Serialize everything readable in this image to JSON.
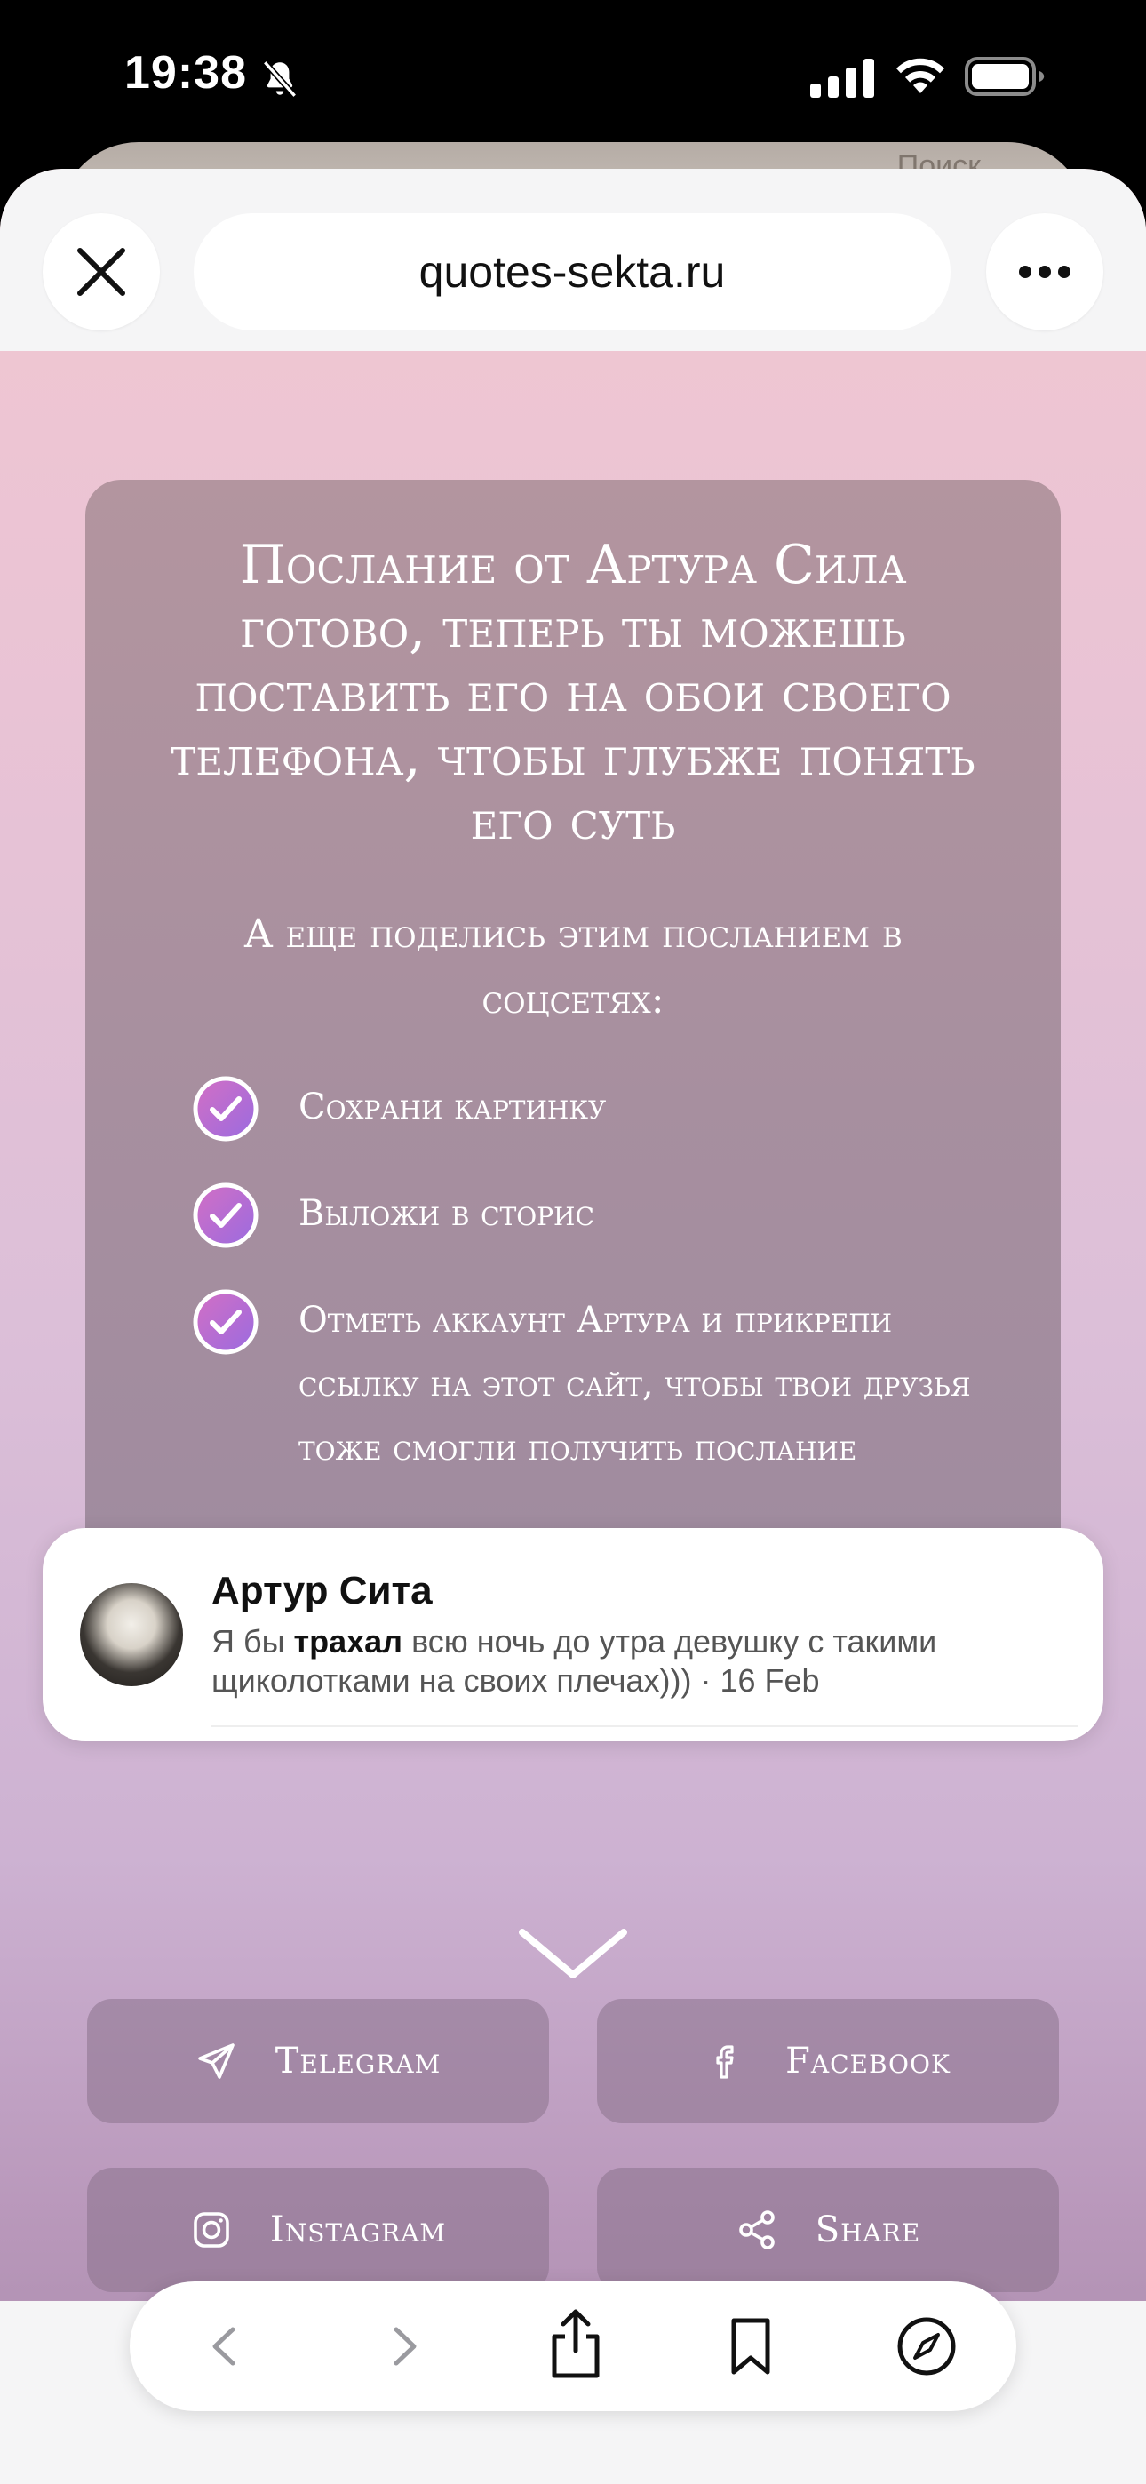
{
  "status_bar": {
    "time": "19:38",
    "icons": [
      "bell-slash-icon",
      "signal-icon",
      "wifi-icon",
      "battery-icon"
    ]
  },
  "browser": {
    "url": "quotes-sekta.ru",
    "back_card_text": "Поиск"
  },
  "message_card": {
    "title": "Послание от Артура Сила готово, теперь ты можешь поставить его на обои своего телефона, чтобы глубже понять его суть",
    "subtitle": "А еще поделись этим посланием в соцсетях:",
    "steps": [
      "Сохрани картинку",
      "Выложи в сторис",
      "Отметь аккаунт Артура и прикрепи ссылку на этот сайт, чтобы твои друзья тоже смогли получить послание"
    ]
  },
  "notification": {
    "name": "Артур Сита",
    "text_before": "Я бы ",
    "text_bold": "трахал",
    "text_after": " всю ночь до утра девушку с такими щиколотками на своих плечах)))",
    "date": " · 16 Feb"
  },
  "share_buttons": {
    "telegram": "Telegram",
    "facebook": "Facebook",
    "instagram": "Instagram",
    "share": "Share"
  },
  "toolbar_icons": [
    "back-icon",
    "forward-icon",
    "share-icon",
    "bookmarks-icon",
    "compass-icon"
  ],
  "colors": {
    "card": "#a78f9f",
    "check_gradient_start": "#d36fc4",
    "check_gradient_end": "#9a6be0",
    "toolbar_icon": "#111111",
    "toolbar_icon_disabled": "#9a9a9f"
  }
}
